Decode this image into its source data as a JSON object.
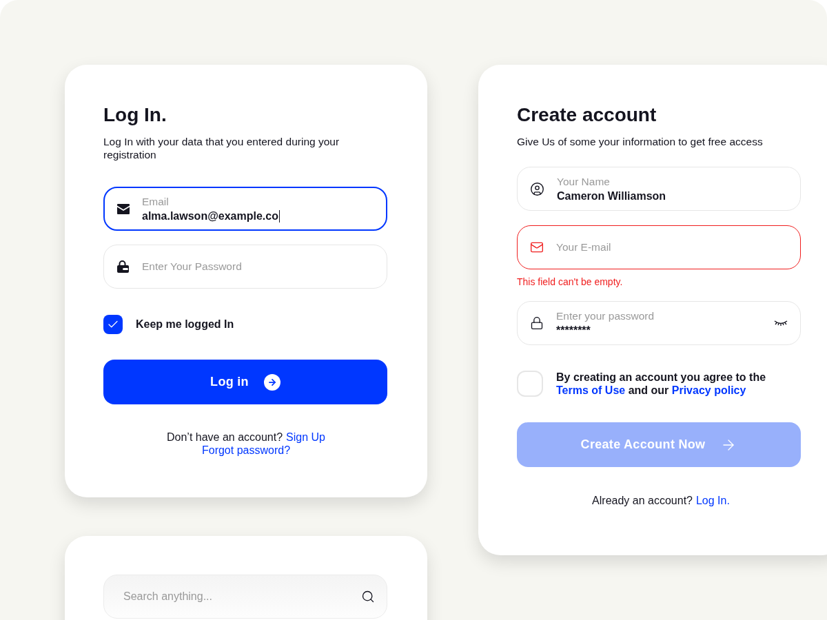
{
  "login": {
    "title": "Log In.",
    "subtitle": "Log In with your data that you entered during your registration",
    "fields": [
      {
        "kind": "email",
        "label": "Email",
        "value": "alma.lawson@example.co",
        "focused": true
      },
      {
        "kind": "password",
        "placeholder": "Enter Your Password",
        "focused": false
      }
    ],
    "remember": {
      "label": "Keep me logged In",
      "checked": true
    },
    "button": {
      "label": "Log in"
    },
    "signup_prompt": {
      "text": "Don’t have an account?",
      "link": "Sign Up"
    },
    "forgot_link": "Forgot password?"
  },
  "signup": {
    "title": "Create account",
    "subtitle": "Give Us of some your information to get free access",
    "fields": [
      {
        "kind": "name",
        "label": "Your Name",
        "value": "Cameron Williamson",
        "error": false
      },
      {
        "kind": "email",
        "placeholder": "Your E-mail",
        "error": true,
        "error_text": "This field can't be empty."
      },
      {
        "kind": "password",
        "label": "Enter your password",
        "value": "********",
        "error": false
      }
    ],
    "terms": {
      "checked": false,
      "text_before": "By creating an account you agree to the",
      "terms_link": "Terms of Use",
      "text_middle": "and our",
      "privacy_link": "Privacy policy"
    },
    "button": {
      "label": "Create Account Now",
      "disabled": true
    },
    "login_prompt": {
      "text": "Already an account?",
      "link": "Log In."
    }
  },
  "search": {
    "placeholder": "Search anything..."
  }
}
